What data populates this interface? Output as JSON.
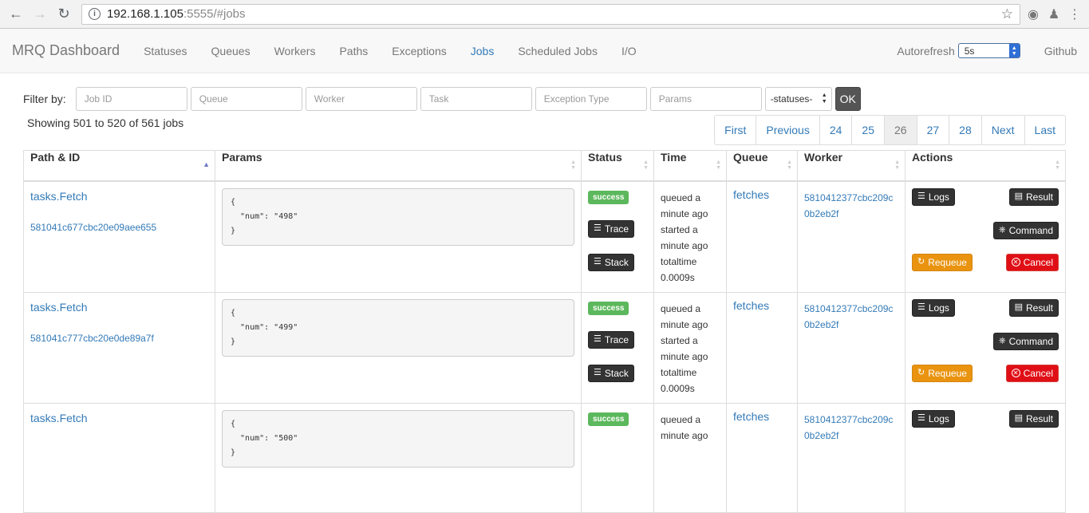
{
  "browser": {
    "url_host": "192.168.1.105",
    "url_rest": ":5555/#jobs"
  },
  "navbar": {
    "brand": "MRQ Dashboard",
    "links": [
      "Statuses",
      "Queues",
      "Workers",
      "Paths",
      "Exceptions",
      "Jobs",
      "Scheduled Jobs",
      "I/O"
    ],
    "active": "Jobs",
    "autorefresh_label": "Autorefresh",
    "autorefresh_value": "5s",
    "github": "Github"
  },
  "filter": {
    "label": "Filter by:",
    "placeholders": [
      "Job ID",
      "Queue",
      "Worker",
      "Task",
      "Exception Type",
      "Params"
    ],
    "statuses_value": "-statuses-",
    "ok_label": "OK"
  },
  "showing": "Showing 501 to 520 of 561 jobs",
  "pagination": [
    "First",
    "Previous",
    "24",
    "25",
    "26",
    "27",
    "28",
    "Next",
    "Last"
  ],
  "pagination_active": "26",
  "columns": [
    "Path & ID",
    "Params",
    "Status",
    "Time",
    "Queue",
    "Worker",
    "Actions"
  ],
  "jobs": [
    {
      "path": "tasks.Fetch",
      "id": "581041c677cbc20e09aee655",
      "params": "{\n  \"num\": \"498\"\n}",
      "status": "success",
      "time_lines": [
        "queued a",
        "minute ago",
        "started a",
        "minute ago",
        "totaltime",
        "0.0009s"
      ],
      "queue": "fetches",
      "worker": "5810412377cbc209c0b2eb2f"
    },
    {
      "path": "tasks.Fetch",
      "id": "581041c777cbc20e0de89a7f",
      "params": "{\n  \"num\": \"499\"\n}",
      "status": "success",
      "time_lines": [
        "queued a",
        "minute ago",
        "started a",
        "minute ago",
        "totaltime",
        "0.0009s"
      ],
      "queue": "fetches",
      "worker": "5810412377cbc209c0b2eb2f"
    },
    {
      "path": "tasks.Fetch",
      "id": "",
      "params": "{\n  \"num\": \"500\"\n}",
      "status": "success",
      "time_lines": [
        "queued a",
        "minute ago"
      ],
      "queue": "fetches",
      "worker": "5810412377cbc209c0b2eb2f"
    }
  ],
  "buttons": {
    "trace": "Trace",
    "stack": "Stack",
    "logs": "Logs",
    "result": "Result",
    "command": "Command",
    "requeue": "Requeue",
    "cancel": "Cancel"
  }
}
